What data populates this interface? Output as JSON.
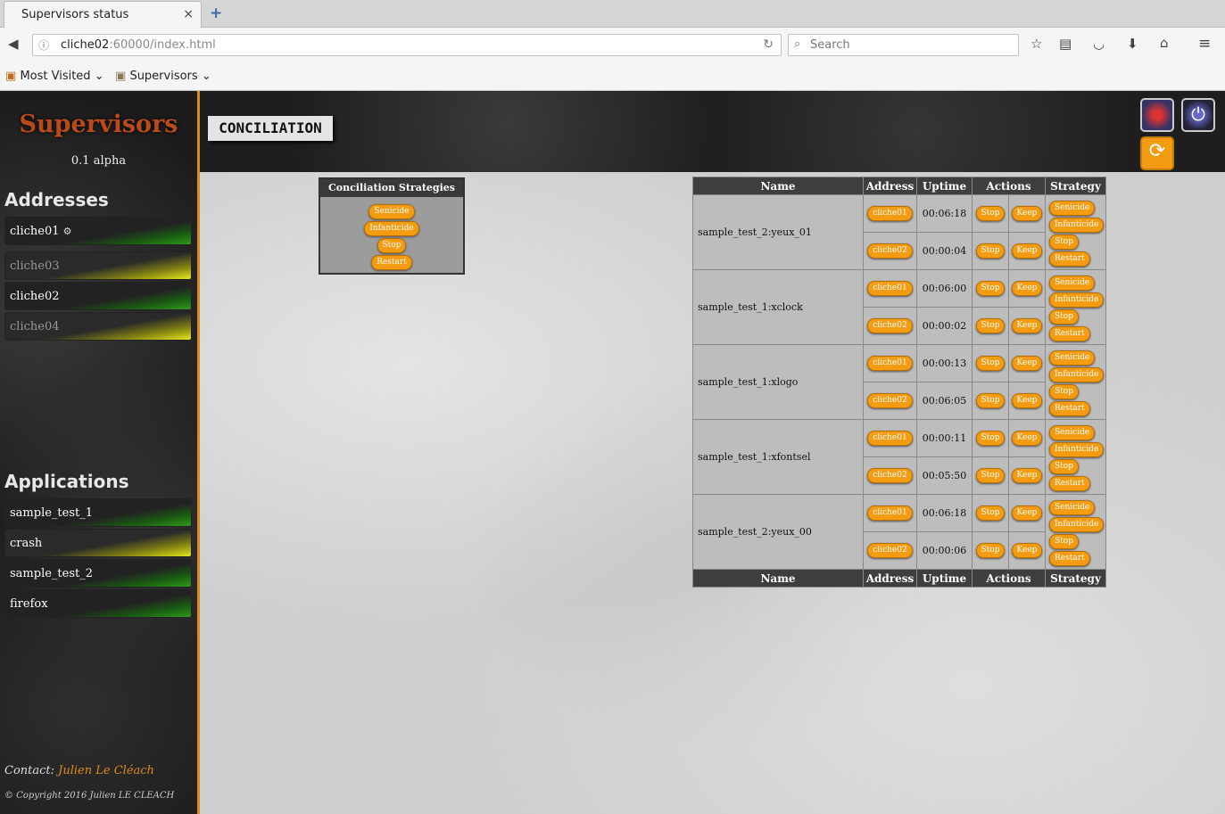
{
  "browser": {
    "tab_title": "Supervisors status",
    "tab_close": "×",
    "new_tab": "+",
    "url_host": "cliche02",
    "url_rest": ":60000/index.html",
    "search_placeholder": "Search",
    "bookmarks": [
      "Most Visited",
      "Supervisors"
    ]
  },
  "sidebar": {
    "brand": "Supervisors",
    "version": "0.1 alpha",
    "addresses_title": "Addresses",
    "addresses": [
      {
        "label": "cliche01",
        "status": "green",
        "master": true
      },
      {
        "label": "cliche03",
        "status": "yellow",
        "master": false
      },
      {
        "label": "cliche02",
        "status": "green",
        "master": false
      },
      {
        "label": "cliche04",
        "status": "yellow",
        "master": false
      }
    ],
    "applications_title": "Applications",
    "applications": [
      {
        "label": "sample_test_1",
        "status": "green"
      },
      {
        "label": "crash",
        "status": "yellow"
      },
      {
        "label": "sample_test_2",
        "status": "green"
      },
      {
        "label": "firefox",
        "status": "green"
      }
    ],
    "contact_label": "Contact:",
    "contact_name": "Julien Le Cléach",
    "copyright": "© Copyright 2016 Julien LE CLEACH"
  },
  "header": {
    "page_title": "CONCILIATION"
  },
  "strategies": {
    "title": "Conciliation Strategies",
    "buttons": [
      "Senicide",
      "Infanticide",
      "Stop",
      "Restart"
    ]
  },
  "table": {
    "headers": [
      "Name",
      "Address",
      "Uptime",
      "Actions",
      "Strategy"
    ],
    "action_labels": [
      "Stop",
      "Keep"
    ],
    "strategy_labels": [
      "Senicide",
      "Infanticide",
      "Stop",
      "Restart"
    ],
    "rows": [
      {
        "name": "sample_test_2:yeux_01",
        "entries": [
          {
            "address": "cliche01",
            "uptime": "00:06:18"
          },
          {
            "address": "cliche02",
            "uptime": "00:00:04"
          }
        ]
      },
      {
        "name": "sample_test_1:xclock",
        "entries": [
          {
            "address": "cliche01",
            "uptime": "00:06:00"
          },
          {
            "address": "cliche02",
            "uptime": "00:00:02"
          }
        ]
      },
      {
        "name": "sample_test_1:xlogo",
        "entries": [
          {
            "address": "cliche01",
            "uptime": "00:00:13"
          },
          {
            "address": "cliche02",
            "uptime": "00:06:05"
          }
        ]
      },
      {
        "name": "sample_test_1:xfontsel",
        "entries": [
          {
            "address": "cliche01",
            "uptime": "00:00:11"
          },
          {
            "address": "cliche02",
            "uptime": "00:05:50"
          }
        ]
      },
      {
        "name": "sample_test_2:yeux_00",
        "entries": [
          {
            "address": "cliche01",
            "uptime": "00:06:18"
          },
          {
            "address": "cliche02",
            "uptime": "00:00:06"
          }
        ]
      }
    ]
  },
  "colors": {
    "accent": "#e08a1a",
    "button": "#f39c12",
    "brand": "#b84a1c"
  }
}
